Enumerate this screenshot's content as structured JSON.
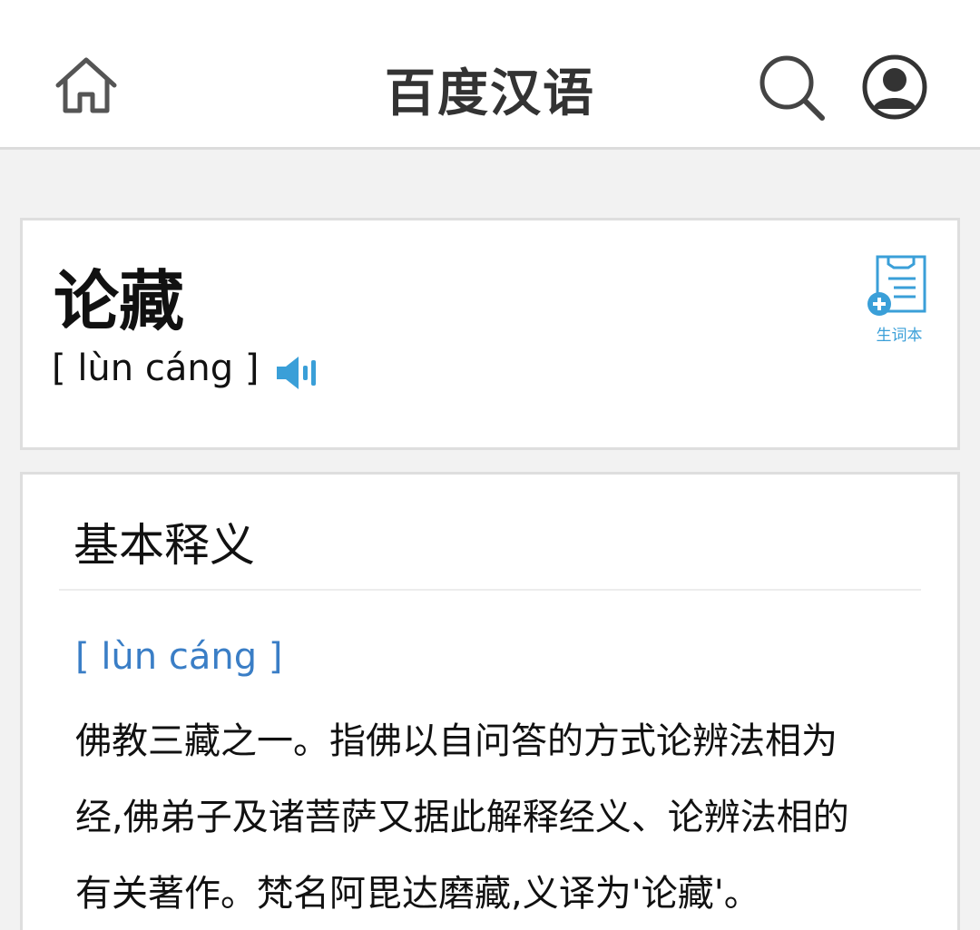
{
  "header": {
    "title": "百度汉语",
    "home_icon": "home-icon",
    "search_icon": "search-icon",
    "user_icon": "user-avatar-icon"
  },
  "word_card": {
    "word": "论藏",
    "pinyin": "[ lùn cáng ]",
    "speaker_icon": "speaker-icon",
    "vocab_button_label": "生词本",
    "accent_color": "#3a9fd8"
  },
  "definition_card": {
    "section_title": "基本释义",
    "pinyin": "[ lùn cáng ]",
    "lines": [
      "佛教三藏之一。指佛以自问答的方式论辨法相为",
      "经,佛弟子及诸菩萨又据此解释经义、论辨法相的",
      "有关著作。梵名阿毘达磨藏,义译为'论藏'。"
    ],
    "pinyin_color": "#3a7ec6"
  }
}
